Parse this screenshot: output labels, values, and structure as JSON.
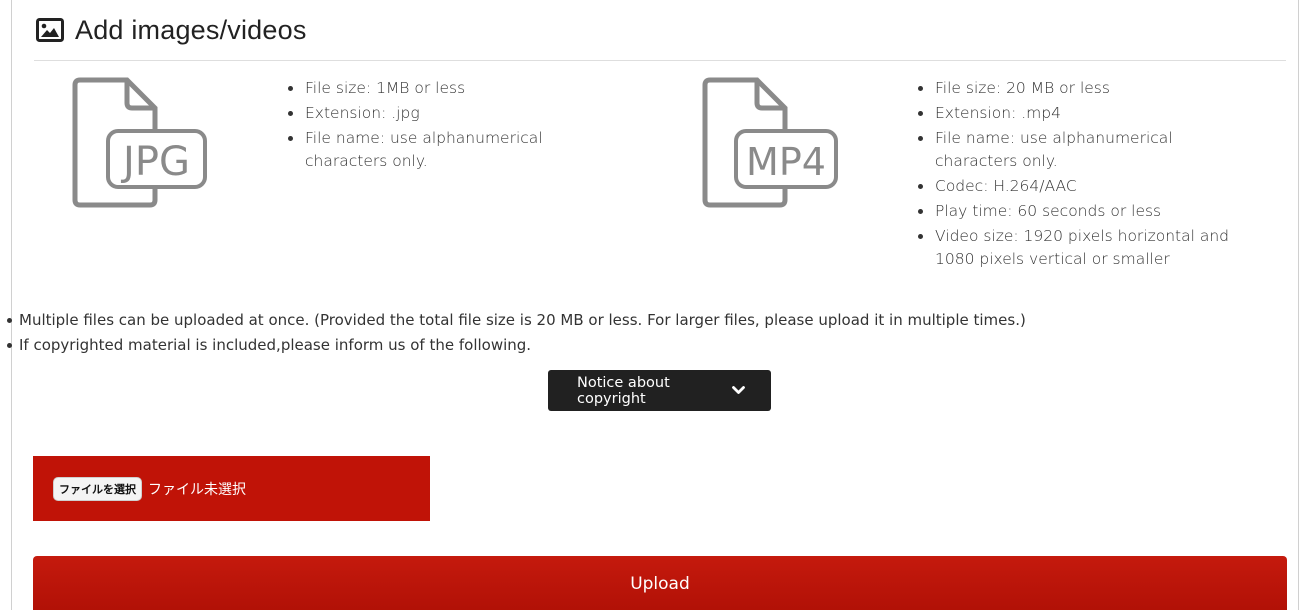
{
  "header": {
    "title": "Add images/videos",
    "icon": "image-icon"
  },
  "image_spec": {
    "icon_label": "JPG",
    "items": [
      "File size: 1MB or less",
      "Extension: .jpg",
      "File name: use alphanumerical characters only."
    ]
  },
  "video_spec": {
    "icon_label": "MP4",
    "items": [
      "File size: 20 MB or less",
      "Extension: .mp4",
      "File name: use alphanumerical characters only.",
      "Codec: H.264/AAC",
      "Play time: 60 seconds or less",
      "Video size: 1920 pixels horizontal and 1080 pixels vertical or smaller"
    ]
  },
  "notes": [
    "Multiple files can be uploaded at once. (Provided the total file size is 20 MB or less. For larger files, please upload it in multiple times.)",
    "If copyrighted material is included,please inform us of the following."
  ],
  "notice": {
    "label": "Notice about copyright",
    "icon": "chevron-down-icon"
  },
  "file_input": {
    "button_label": "ファイルを選択",
    "status": "ファイル未選択"
  },
  "upload": {
    "label": "Upload"
  },
  "colors": {
    "accent": "#c01307",
    "dark_button": "#212121",
    "icon_gray": "#8a8a8a"
  }
}
